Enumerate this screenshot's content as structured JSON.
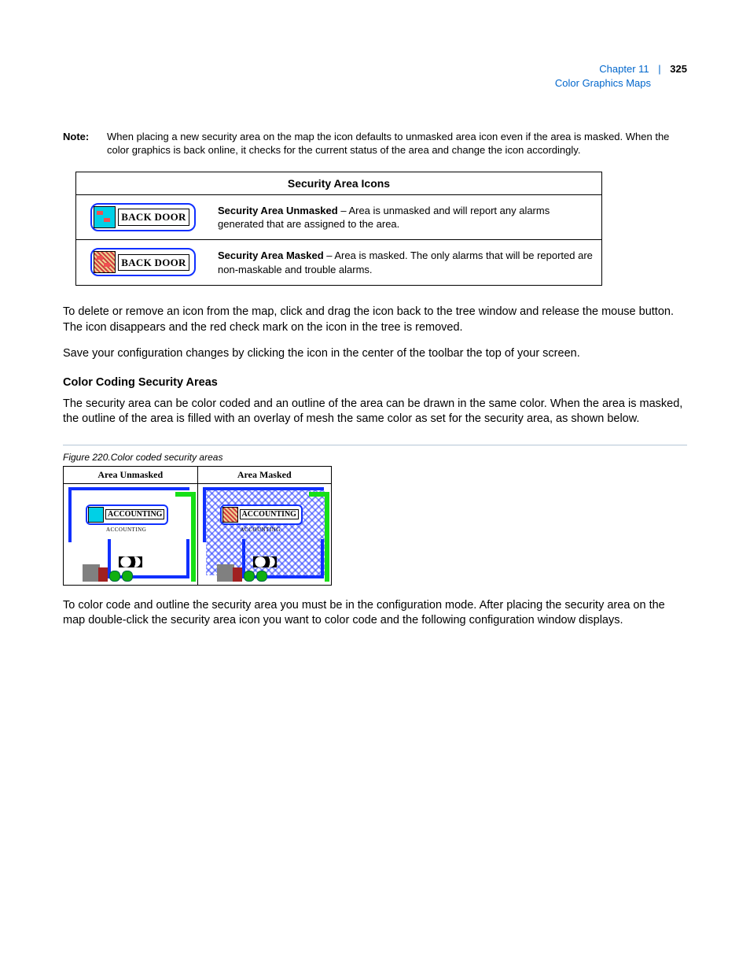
{
  "header": {
    "chapter": "Chapter 11",
    "page": "325",
    "title": "Color Graphics Maps"
  },
  "note": {
    "label": "Note:",
    "text": "When placing a new security area on the map the icon defaults to unmasked area icon even if the area is masked. When the color graphics is back online, it checks for the current status of the area and change the icon accordingly."
  },
  "table": {
    "heading": "Security Area Icons",
    "rows": [
      {
        "icon_label": "BACK DOOR",
        "title": "Security Area Unmasked",
        "desc": " – Area is unmasked and will report any alarms generated that are assigned to the area."
      },
      {
        "icon_label": "BACK DOOR",
        "title": "Security Area Masked",
        "desc": " – Area is masked. The only alarms that will be reported are non-maskable and trouble alarms."
      }
    ]
  },
  "para1": "To delete or remove an icon from the map, click and drag the icon back to the tree window and release the mouse button. The icon disappears and the red check mark on the icon in the tree is removed.",
  "para2": "Save your configuration changes by clicking the icon in the center of the toolbar the top of your screen.",
  "subheading": "Color Coding Security Areas",
  "para3": "The security area can be color coded and an outline of the area can be drawn in the same color. When the area is masked, the outline of the area is filled with an overlay of mesh the same color as set for the security area, as shown below.",
  "figure": {
    "caption": "Figure 220.Color coded security areas",
    "panel1": {
      "cap": "Area Unmasked",
      "badge": "ACCOUNTING",
      "tiny": "ACCOUNTING"
    },
    "panel2": {
      "cap": "Area Masked",
      "badge": "ACCOUNTING",
      "tiny": "ACCOUNTING"
    }
  },
  "para4": "To color code and outline the security area you must be in the configuration mode. After placing the security area on the map double-click the security area icon you want to color code and the following configuration window displays."
}
